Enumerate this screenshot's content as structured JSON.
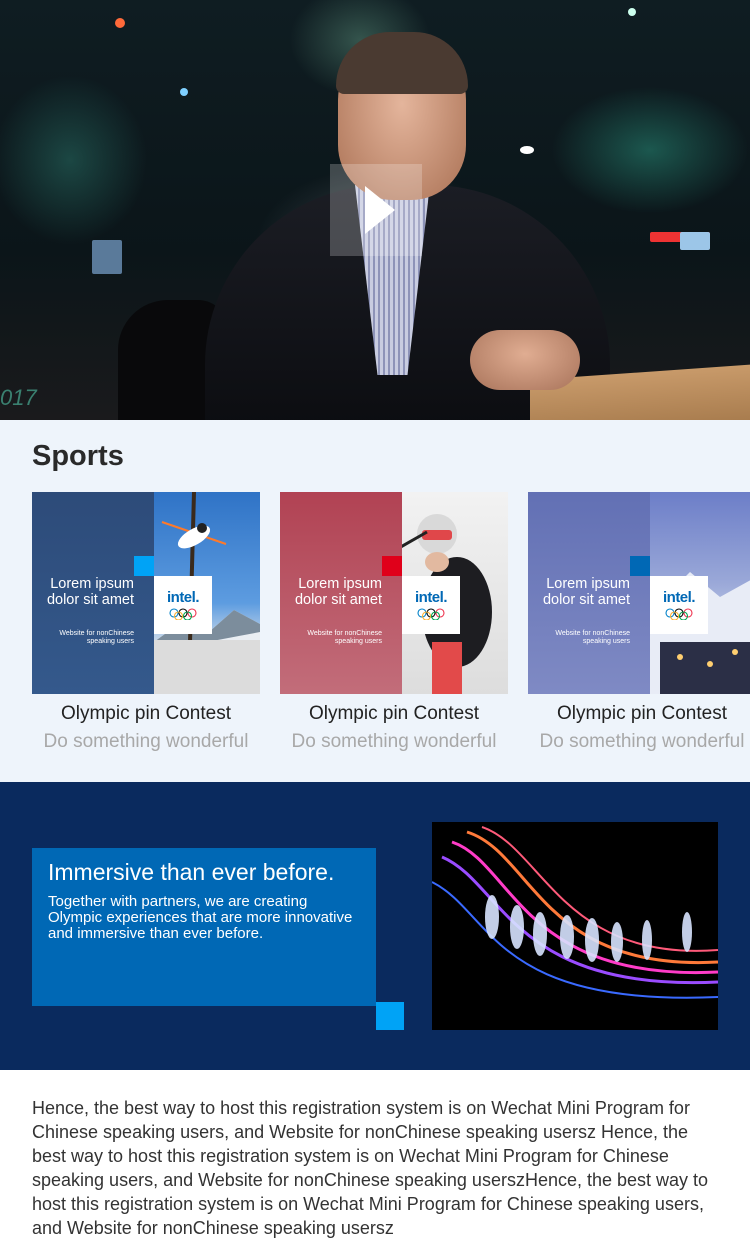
{
  "hero": {
    "year_text": "017",
    "play_label": "play"
  },
  "sports": {
    "title": "Sports",
    "cards": [
      {
        "lorem": "Lorem ipsum dolor sit amet",
        "sublabel": "Website for nonChinese speaking users",
        "logo": "intel.",
        "title": "Olympic pin Contest",
        "subtitle": "Do something wonderful",
        "accent_color": "#00a3f6",
        "left_color": "#2e4d7c",
        "image_icon": "ski-jump-icon"
      },
      {
        "lorem": "Lorem ipsum dolor sit amet",
        "sublabel": "Website for nonChinese speaking users",
        "logo": "intel.",
        "title": "Olympic pin Contest",
        "subtitle": "Do something wonderful",
        "accent_color": "#e0001a",
        "left_color": "#b44a5a",
        "image_icon": "skier-icon"
      },
      {
        "lorem": "Lorem ipsum dolor sit amet",
        "sublabel": "Website for nonChinese speaking users",
        "logo": "intel.",
        "title": "Olympic pin Contest",
        "subtitle": "Do something wonderful",
        "accent_color": "#0068b5",
        "left_color": "#5f6fae",
        "image_icon": "snow-village-icon"
      }
    ]
  },
  "immersive": {
    "title": "Immersive than ever before.",
    "body": "Together with partners, we are creating Olympic experiences that are more innovative and immersive than ever before.",
    "photo_icon": "light-skaters-icon",
    "box_color": "#0068b5",
    "bg_color": "#0a2a5e"
  },
  "paragraph": {
    "text": "Hence, the best way to host this registration system is on Wechat Mini Program for Chinese speaking users, and Website for nonChinese speaking usersz Hence, the best way to host this registration system is on Wechat Mini Program for Chinese speaking users, and Website for nonChinese speaking userszHence, the best way to host this registration system is on Wechat Mini Program for Chinese speaking users, and Website for nonChinese speaking usersz"
  }
}
